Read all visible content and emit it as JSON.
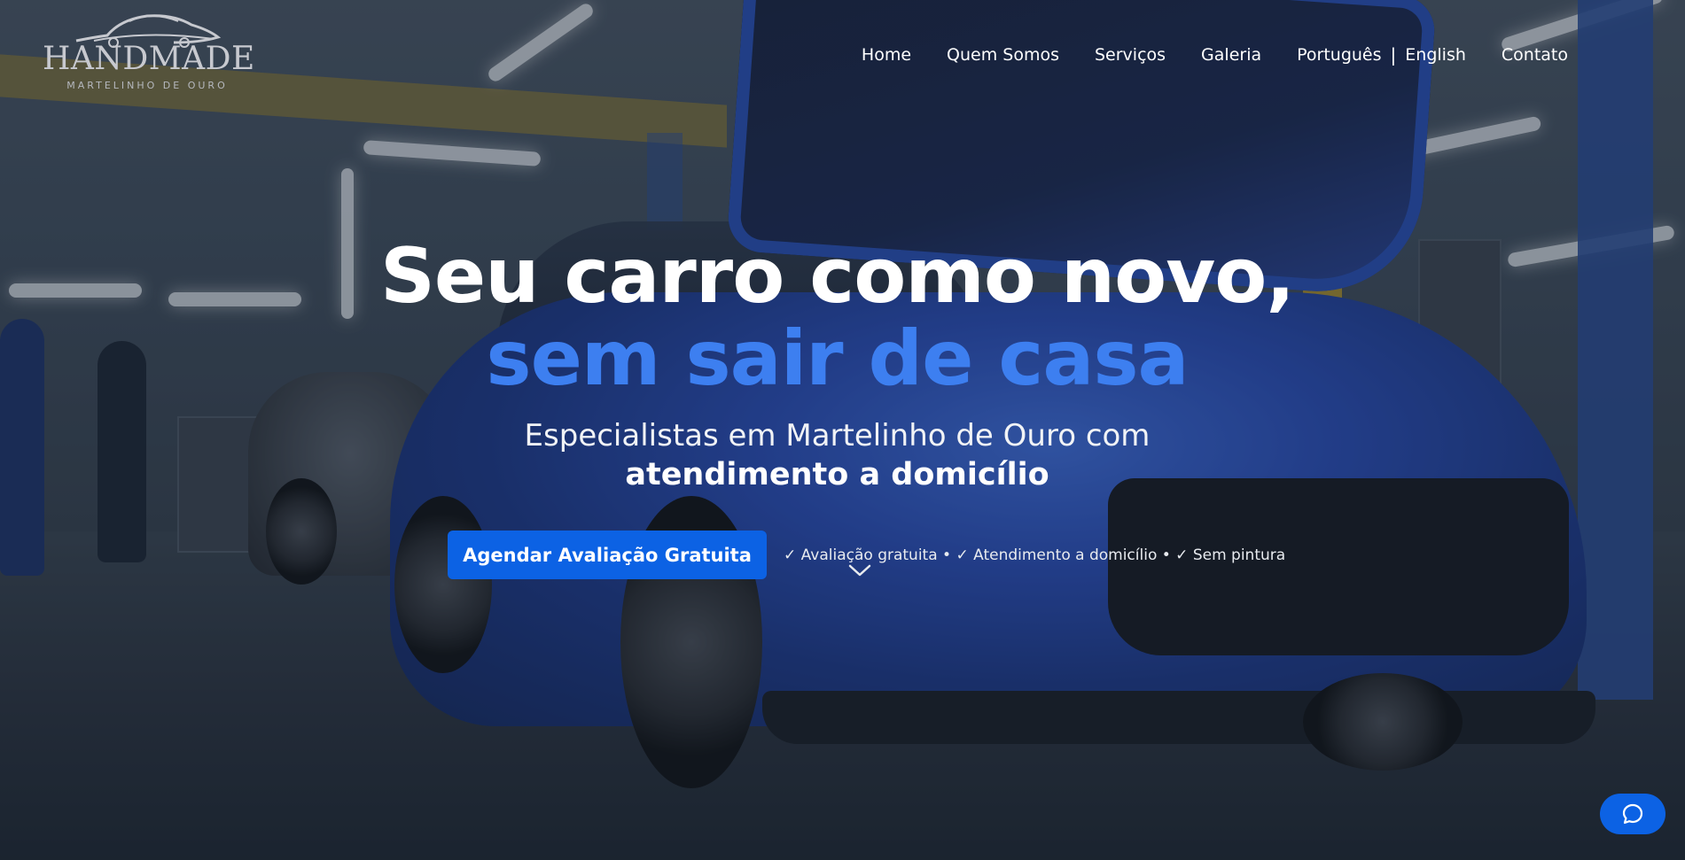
{
  "brand": {
    "name": "HANDMADE",
    "tagline": "MARTELINHO DE OURO",
    "logo_icon": "car-silhouette-icon"
  },
  "nav": {
    "items": [
      {
        "label": "Home"
      },
      {
        "label": "Quem Somos"
      },
      {
        "label": "Serviços"
      },
      {
        "label": "Galeria"
      }
    ],
    "languages": {
      "pt": "Português",
      "separator": "|",
      "en": "English"
    },
    "contact": "Contato"
  },
  "hero": {
    "headline_line1": "Seu carro como novo,",
    "headline_line2": "sem sair de casa",
    "subheadline_line1": "Especialistas em Martelinho de Ouro com",
    "subheadline_line2": "atendimento a domicílio",
    "cta_label": "Agendar Avaliação Gratuita",
    "benefits": "✓ Avaliação gratuita • ✓ Atendimento a domicílio • ✓ Sem pintura",
    "scroll_icon": "chevron-down-icon"
  },
  "chat": {
    "icon": "chat-bubble-icon"
  },
  "colors": {
    "accent_blue": "#0c62e4",
    "headline_blue": "#3d7ff0",
    "text_white": "#ffffff"
  }
}
